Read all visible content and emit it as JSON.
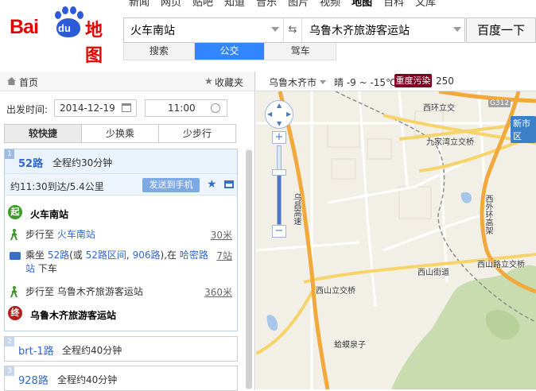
{
  "logo": {
    "brand": "Bai",
    "du": "du",
    "product": "地图"
  },
  "topnav": [
    "新闻",
    "网页",
    "贴吧",
    "知道",
    "音乐",
    "图片",
    "视频",
    "地图",
    "百科",
    "文库"
  ],
  "search": {
    "from": "火车南站",
    "to": "乌鲁木齐旅游客运站",
    "button": "百度一下"
  },
  "modes": [
    "搜索",
    "公交",
    "驾车"
  ],
  "left": {
    "home": "首页",
    "favorites": "收藏夹",
    "depart_label": "出发时间:",
    "date": "2014-12-19",
    "time": "11:00",
    "prefs": [
      "较快捷",
      "少换乘",
      "少步行"
    ],
    "routes": [
      {
        "index": "1",
        "name": "52路",
        "total": "全程约30分钟",
        "arrival": "约11:30到达/5.4公里",
        "send_label": "发送到手机",
        "steps": {
          "start": "火车南站",
          "walk1_prefix": "步行至",
          "walk1_place": "火车南站",
          "walk1_dist": "30米",
          "bus_prefix": "乘坐",
          "bus_line": "52路",
          "bus_alt_open": "(或",
          "bus_alt1": "52路区间",
          "bus_sep": ",",
          "bus_alt2": "906路",
          "bus_alt_close": "),在",
          "bus_stop": "哈密路站",
          "bus_suffix": "下车",
          "bus_dist": "7站",
          "walk2_text": "步行至 乌鲁木齐旅游客运站",
          "walk2_dist": "360米",
          "end": "乌鲁木齐旅游客运站",
          "start_badge": "起",
          "end_badge": "终"
        }
      },
      {
        "index": "2",
        "name": "brt-1路",
        "total": "全程约40分钟"
      },
      {
        "index": "3",
        "name": "928路",
        "total": "全程约40分钟"
      }
    ]
  },
  "mapbar": {
    "city": "乌鲁木齐市",
    "weather": "晴 -9 ~ -15℃",
    "aqi_label": "重度污染",
    "aqi_value": "250"
  },
  "map": {
    "labels": {
      "xihuanlijiao": "西环立交",
      "g312": "G312",
      "xinshiqu": "新市区",
      "jiujiawan": "九家湾立交桥",
      "wuchang": "乌昌高速",
      "xihuan_gaosu": "西外环高架",
      "xishanlujiao": "西山路立交桥",
      "xishanjiedao": "西山街道",
      "xishanlijiao": "西山立交桥",
      "hamajingzi": "蛤蟆泉子"
    },
    "zoom_plus": "+",
    "zoom_minus": "−"
  }
}
